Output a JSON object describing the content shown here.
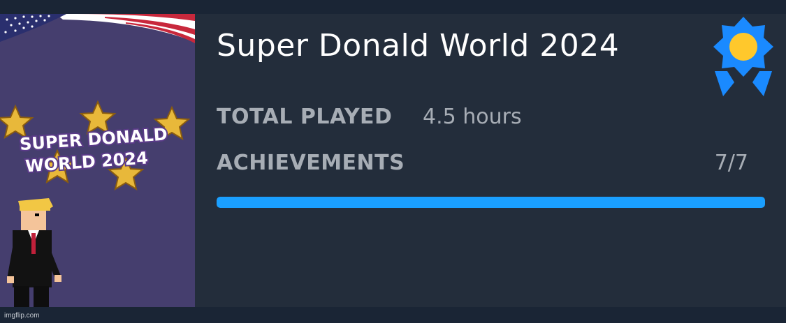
{
  "game": {
    "title": "Super Donald World 2024",
    "cover_logo_line1": "SUPER DONALD",
    "cover_logo_line2": "WORLD 2024"
  },
  "stats": {
    "total_played_label": "TOTAL PLAYED",
    "total_played_value": "4.5 hours",
    "achievements_label": "ACHIEVEMENTS",
    "achievements_value": "7/7",
    "achievements_progress": 1.0
  },
  "icons": {
    "badge": "award-ribbon-icon"
  },
  "colors": {
    "accent": "#1a9fff",
    "background": "#232d3b",
    "badge_sun": "#ffc82c"
  },
  "footer": {
    "watermark": "imgflip.com"
  }
}
